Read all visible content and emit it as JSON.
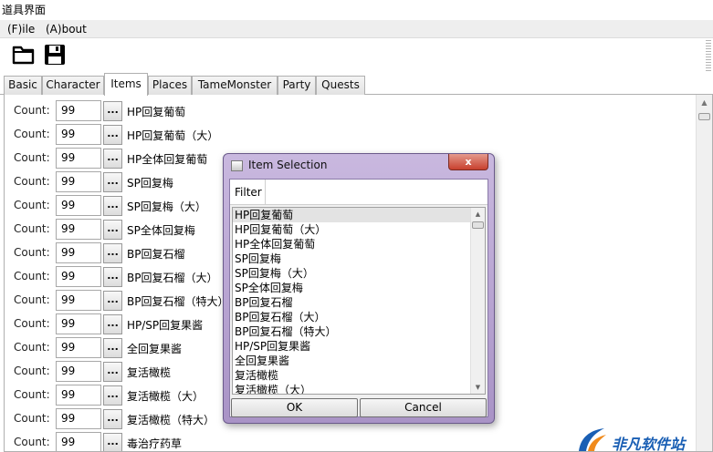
{
  "window": {
    "title": "道具界面"
  },
  "menu": {
    "items": [
      "(F)ile",
      "(A)bout"
    ]
  },
  "toolbar": {
    "buttons": [
      "open-folder-icon",
      "save-icon"
    ]
  },
  "tabs": [
    "Basic",
    "Character",
    "Items",
    "Places",
    "TameMonster",
    "Party",
    "Quests"
  ],
  "active_tab": "Items",
  "items_panel": {
    "count_label": "Count:",
    "browse_label": "...",
    "rows": [
      {
        "count": "99",
        "name": "HP回复葡萄"
      },
      {
        "count": "99",
        "name": "HP回复葡萄（大）"
      },
      {
        "count": "99",
        "name": "HP全体回复葡萄"
      },
      {
        "count": "99",
        "name": "SP回复梅"
      },
      {
        "count": "99",
        "name": "SP回复梅（大）"
      },
      {
        "count": "99",
        "name": "SP全体回复梅"
      },
      {
        "count": "99",
        "name": "BP回复石榴"
      },
      {
        "count": "99",
        "name": "BP回复石榴（大）"
      },
      {
        "count": "99",
        "name": "BP回复石榴（特大）"
      },
      {
        "count": "99",
        "name": "HP/SP回复果酱"
      },
      {
        "count": "99",
        "name": "全回复果酱"
      },
      {
        "count": "99",
        "name": "复活橄榄"
      },
      {
        "count": "99",
        "name": "复活橄榄（大）"
      },
      {
        "count": "99",
        "name": "复活橄榄（特大）"
      },
      {
        "count": "99",
        "name": "毒治疗药草"
      }
    ]
  },
  "dialog": {
    "title": "Item Selection",
    "close_label": "x",
    "filter_label": "Filter",
    "list": [
      "HP回复葡萄",
      "HP回复葡萄（大）",
      "HP全体回复葡萄",
      "SP回复梅",
      "SP回复梅（大）",
      "SP全体回复梅",
      "BP回复石榴",
      "BP回复石榴（大）",
      "BP回复石榴（特大）",
      "HP/SP回复果酱",
      "全回复果酱",
      "复活橄榄",
      "复活橄榄（大）"
    ],
    "selected_index": 0,
    "ok_label": "OK",
    "cancel_label": "Cancel"
  },
  "watermark": {
    "text": "非凡软件站"
  },
  "colors": {
    "dialog_frame": "#b9a6d3",
    "close_button": "#c8402e",
    "watermark": "#1a5fb4"
  }
}
